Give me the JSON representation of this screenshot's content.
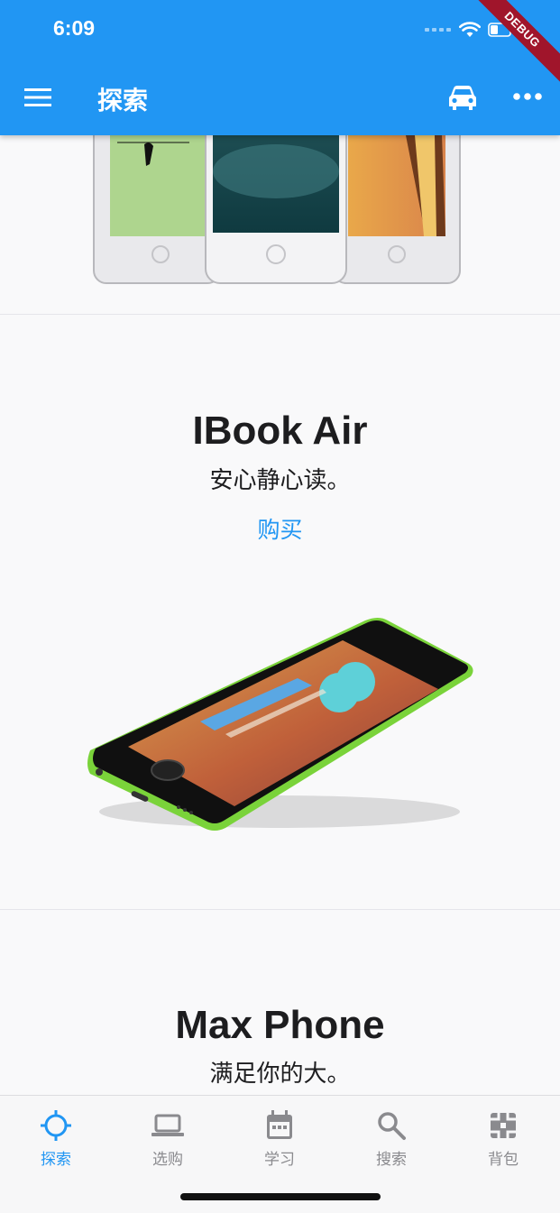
{
  "status_bar": {
    "time": "6:09",
    "debug_label": "DEBUG"
  },
  "app_bar": {
    "title": "探索"
  },
  "products": [
    {
      "title": "IBook Air",
      "subtitle": "安心静心读。",
      "buy_label": "购买"
    },
    {
      "title": "Max Phone",
      "subtitle": "满足你的大。"
    }
  ],
  "tabs": [
    {
      "label": "探索",
      "icon": "crosshair-icon",
      "active": true
    },
    {
      "label": "选购",
      "icon": "laptop-icon",
      "active": false
    },
    {
      "label": "学习",
      "icon": "calendar-icon",
      "active": false
    },
    {
      "label": "搜索",
      "icon": "search-icon",
      "active": false
    },
    {
      "label": "背包",
      "icon": "bag-icon",
      "active": false
    }
  ],
  "colors": {
    "primary": "#2196f3",
    "inactive": "#8a8a8e",
    "debug": "#a0152b"
  }
}
